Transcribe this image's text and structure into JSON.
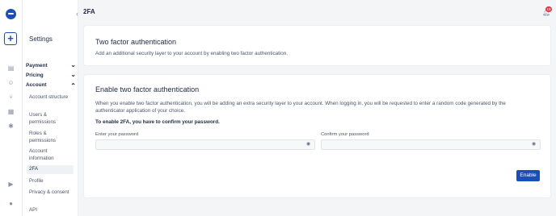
{
  "header": {
    "page_title": "2FA",
    "notification_count": "19"
  },
  "sidebar": {
    "title": "Settings",
    "groups": [
      {
        "label": "Payment",
        "expanded": false
      },
      {
        "label": "Pricing",
        "expanded": false
      },
      {
        "label": "Account",
        "expanded": true
      }
    ],
    "account_items": [
      {
        "label": "Account structure",
        "active": false
      },
      {
        "label": "Users & permissions",
        "active": false
      },
      {
        "label": "Roles & permissions",
        "active": false
      },
      {
        "label": "Account information",
        "active": false
      },
      {
        "label": "2FA",
        "active": true
      },
      {
        "label": "Profile",
        "active": false
      },
      {
        "label": "Privacy & consent",
        "active": false
      },
      {
        "label": "API",
        "active": false
      }
    ]
  },
  "rail": {
    "icons": [
      "logo-icon",
      "add-icon",
      "layers-icon",
      "users-icon",
      "branch-icon",
      "calendar-icon",
      "puzzle-icon",
      "play-icon",
      "bell-icon"
    ]
  },
  "intro_card": {
    "title": "Two factor authentication",
    "description": "Add an additional security layer to your account by enabling two factor authentication."
  },
  "enable_card": {
    "title": "Enable two factor authentication",
    "description": "When you enable two factor authentication, you will be adding an extra security layer to your account. When logging in, you will be requested to enter a random code generated by the authenticator application of your choice.",
    "instruction": "To enable 2FA, you have to confirm your password.",
    "password_label": "Enter your password",
    "password_value": "",
    "confirm_label": "Confirm your password",
    "confirm_value": "",
    "enable_button": "Enable"
  },
  "colors": {
    "accent": "#1a4fb8",
    "badge": "#e0384a",
    "background": "#f4f5f7"
  }
}
